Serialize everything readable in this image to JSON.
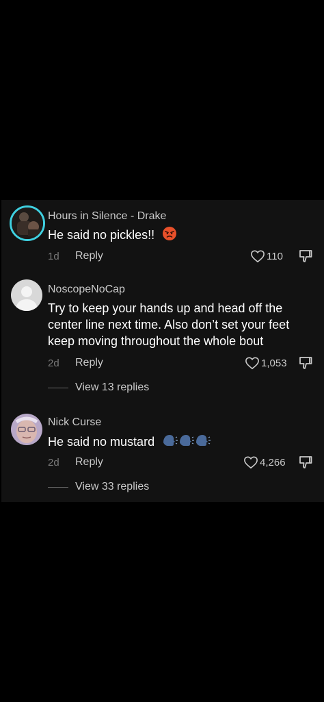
{
  "comments": [
    {
      "username": "Hours in Silence - Drake",
      "text": "He said no pickles!!",
      "emoji": "angry-face-emoji",
      "date": "1d",
      "reply_label": "Reply",
      "likes": "110",
      "avatar": "profile-photo-dark"
    },
    {
      "username": "NoscopeNoCap",
      "text": "Try to keep your hands up and head off the center line next time. Also don’t set your feet keep moving throughout the whole bout",
      "date": "2d",
      "reply_label": "Reply",
      "likes": "1,053",
      "view_replies": "View 13 replies",
      "avatar": "default-avatar"
    },
    {
      "username": "Nick Curse",
      "text": "He said no mustard",
      "emoji": "speaking-head-emoji",
      "date": "2d",
      "reply_label": "Reply",
      "likes": "4,266",
      "view_replies": "View 33 replies",
      "avatar": "profile-photo-face"
    }
  ],
  "colors": {
    "background": "#000000",
    "panel": "#121212",
    "primary_text": "#ffffff",
    "secondary_text": "#c9c9c9",
    "muted_text": "#7a7a7a",
    "story_ring": "#3fd0e0"
  }
}
